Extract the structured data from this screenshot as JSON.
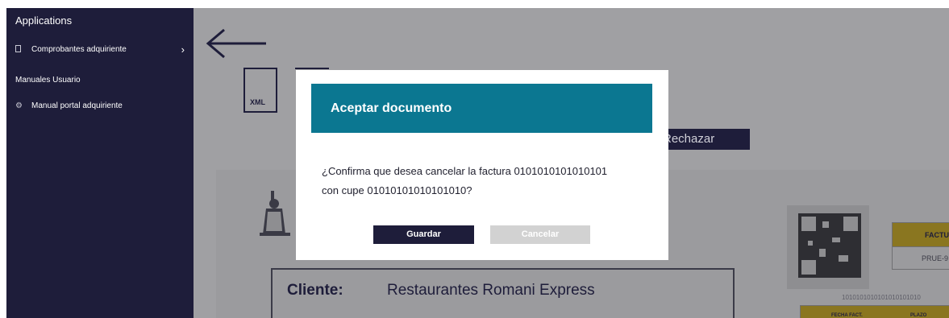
{
  "sidebar": {
    "title": "Applications",
    "items": [
      {
        "label": "Comprobantes adquiriente",
        "icon": "document-icon"
      },
      {
        "label": "Manual portal adquiriente",
        "icon": "gears-icon"
      }
    ],
    "section": "Manuales Usuario"
  },
  "page": {
    "xml_label": "XML",
    "reject_button": "Rechazar"
  },
  "document": {
    "client_label": "Cliente:",
    "client_name": "Restaurantes Romani Express",
    "factura_header": "FACTU",
    "factura_value": "PRUE-9",
    "binary_text": "1010101010101010101010",
    "table_headers": [
      "FECHA FACT.",
      "PLAZO"
    ]
  },
  "modal": {
    "title": "Aceptar documento",
    "message_line1": "¿Confirma que desea cancelar la factura 0101010101010101",
    "message_line2": "con cupe 01010101010101010?",
    "save_label": "Guardar",
    "cancel_label": "Cancelar"
  },
  "colors": {
    "sidebar_bg": "#1e1d3a",
    "modal_header_bg": "#0b7791",
    "overlay": "#a0a0a3",
    "table_header": "#8a7620"
  }
}
